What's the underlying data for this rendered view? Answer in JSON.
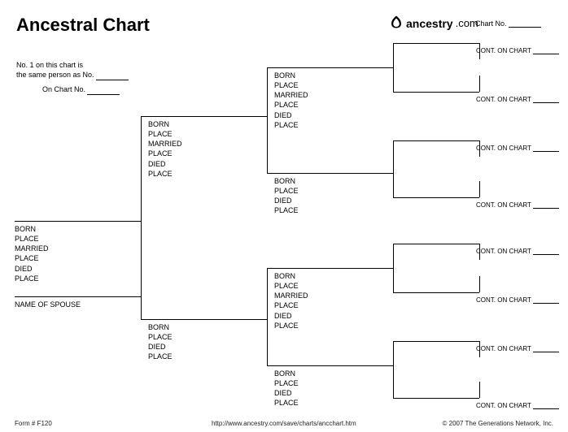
{
  "header": {
    "title": "Ancestral Chart",
    "brand_text": "ancestry",
    "brand_suffix": ".com",
    "chart_no_label": "Chart No."
  },
  "note": {
    "line1": "No. 1 on this chart is",
    "line2_pre": "the same person as No.",
    "line3_pre": "On Chart No."
  },
  "fields_full": {
    "born": "BORN",
    "place1": "PLACE",
    "married": "MARRIED",
    "place2": "PLACE",
    "died": "DIED",
    "place3": "PLACE"
  },
  "fields_short": {
    "born": "BORN",
    "place1": "PLACE",
    "died": "DIED",
    "place2": "PLACE"
  },
  "spouse_label": "NAME OF SPOUSE",
  "cont_label": "CONT. ON CHART",
  "footer": {
    "form": "Form # F120",
    "url": "http://www.ancestry.com/save/charts/ancchart.htm",
    "copyright": "© 2007 The Generations Network, Inc."
  }
}
